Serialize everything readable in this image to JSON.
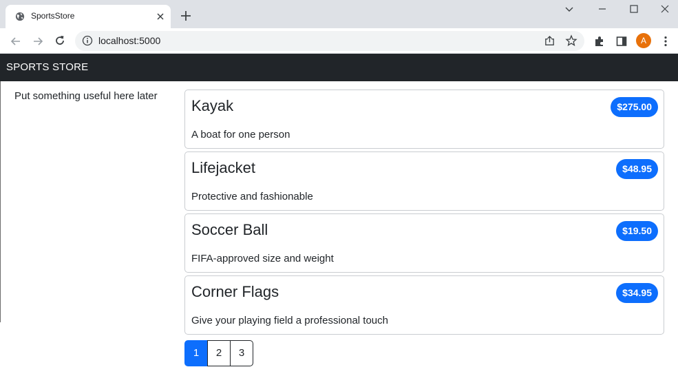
{
  "browser": {
    "tab_title": "SportsStore",
    "url": "localhost:5000",
    "profile_initial": "A"
  },
  "navbar": {
    "brand": "SPORTS STORE"
  },
  "sidebar": {
    "text": "Put something useful here later"
  },
  "products": [
    {
      "name": "Kayak",
      "price": "$275.00",
      "description": "A boat for one person"
    },
    {
      "name": "Lifejacket",
      "price": "$48.95",
      "description": "Protective and fashionable"
    },
    {
      "name": "Soccer Ball",
      "price": "$19.50",
      "description": "FIFA-approved size and weight"
    },
    {
      "name": "Corner Flags",
      "price": "$34.95",
      "description": "Give your playing field a professional touch"
    }
  ],
  "pagination": {
    "pages": [
      "1",
      "2",
      "3"
    ],
    "current": "1"
  },
  "colors": {
    "navbar_bg": "#212529",
    "accent": "#0d6efd",
    "profile_avatar": "#e8710a"
  }
}
